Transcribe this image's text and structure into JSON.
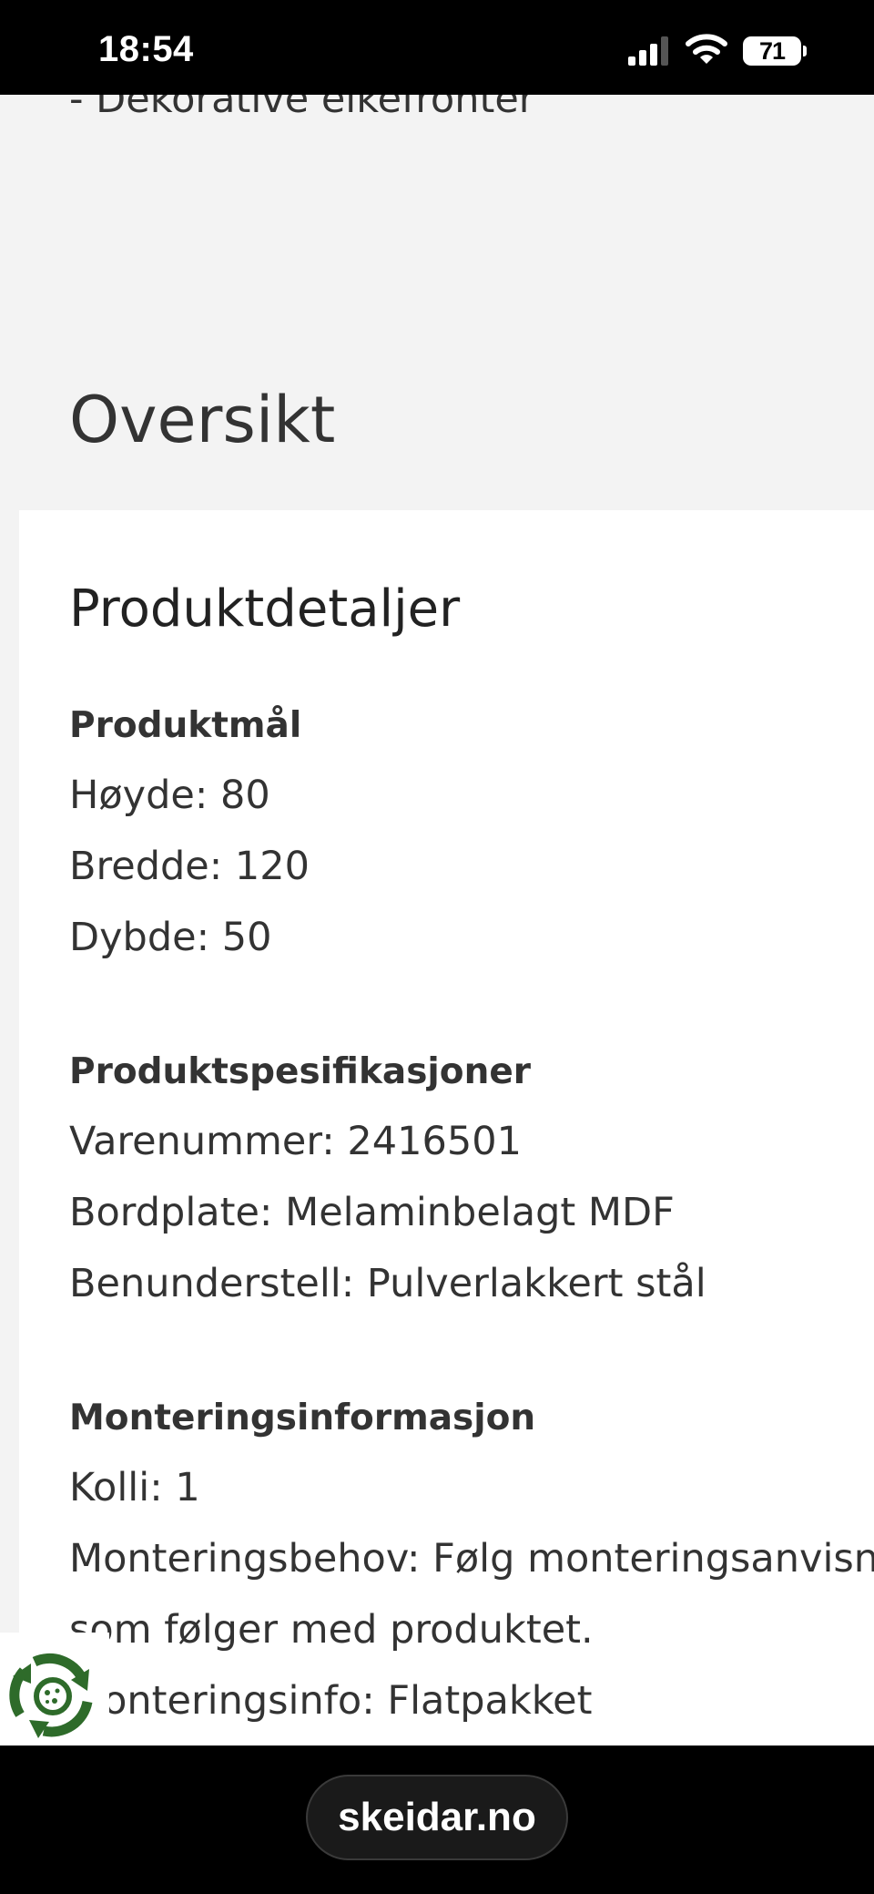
{
  "status_bar": {
    "time": "18:54",
    "battery": "71",
    "icons": [
      "signal-icon",
      "wifi-icon",
      "battery-icon"
    ]
  },
  "page": {
    "partial_top_text": "- Dekorative eikefronter",
    "section_title": "Oversikt",
    "card": {
      "title": "Produktdetaljer",
      "groups": [
        {
          "heading": "Produktmål",
          "lines": [
            "Høyde: 80",
            "Bredde: 120",
            "Dybde: 50"
          ]
        },
        {
          "heading": "Produktspesifikasjoner",
          "lines": [
            "Varenummer: 2416501",
            "Bordplate: Melaminbelagt MDF",
            "Benunderstell: Pulverlakkert stål"
          ]
        },
        {
          "heading": "Monteringsinformasjon",
          "lines": [
            "Kolli: 1",
            "Monteringsbehov: Følg monteringsanvisning",
            "som følger med produktet.",
            "Monteringsinfo: Flatpakket"
          ]
        }
      ]
    }
  },
  "eco_badge": {
    "icon": "recycle-icon",
    "color": "#2e6b2a"
  },
  "browser": {
    "url": "skeidar.no"
  }
}
